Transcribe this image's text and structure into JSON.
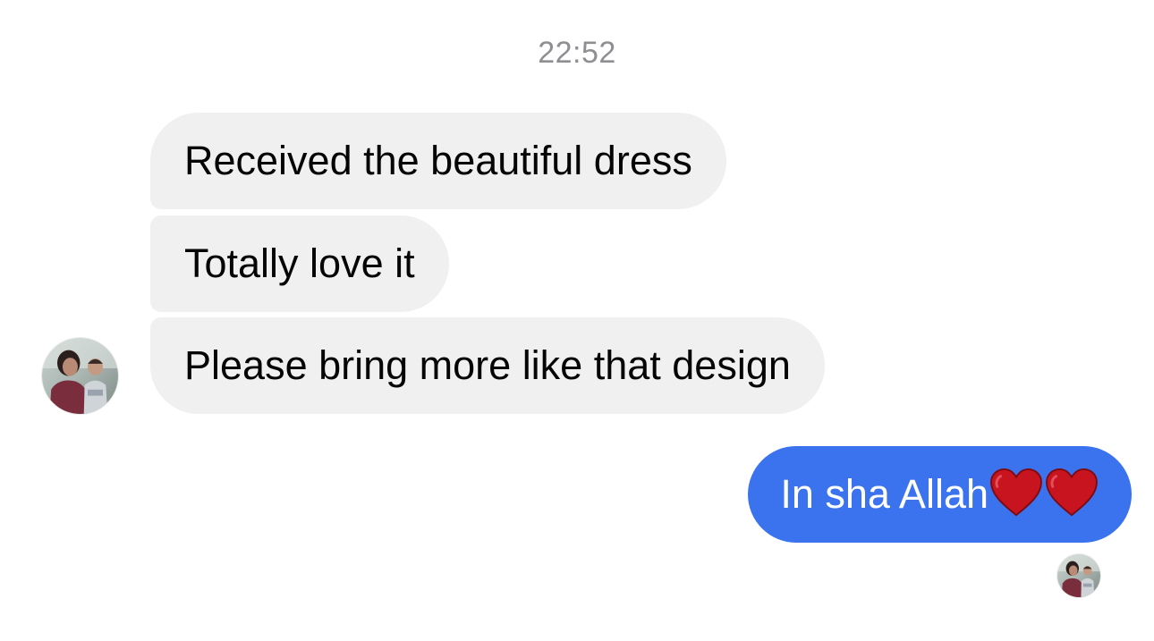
{
  "conversation": {
    "timestamp": "22:52",
    "incoming_messages": [
      {
        "text": "Received the beautiful dress"
      },
      {
        "text": "Totally love it"
      },
      {
        "text": "Please bring more like that design"
      }
    ],
    "outgoing_messages": [
      {
        "text": "In sha Allah",
        "emoji": [
          "red-heart",
          "red-heart"
        ]
      }
    ]
  },
  "colors": {
    "incoming_bubble": "#f0f0f0",
    "outgoing_bubble": "#3b73ef",
    "timestamp": "#8e8e93",
    "heart": "#d21f2b"
  },
  "icons": {
    "contact_avatar": "contact-avatar-photo",
    "read_receipt_avatar": "read-receipt-avatar-photo",
    "emoji": "red-heart-emoji"
  }
}
